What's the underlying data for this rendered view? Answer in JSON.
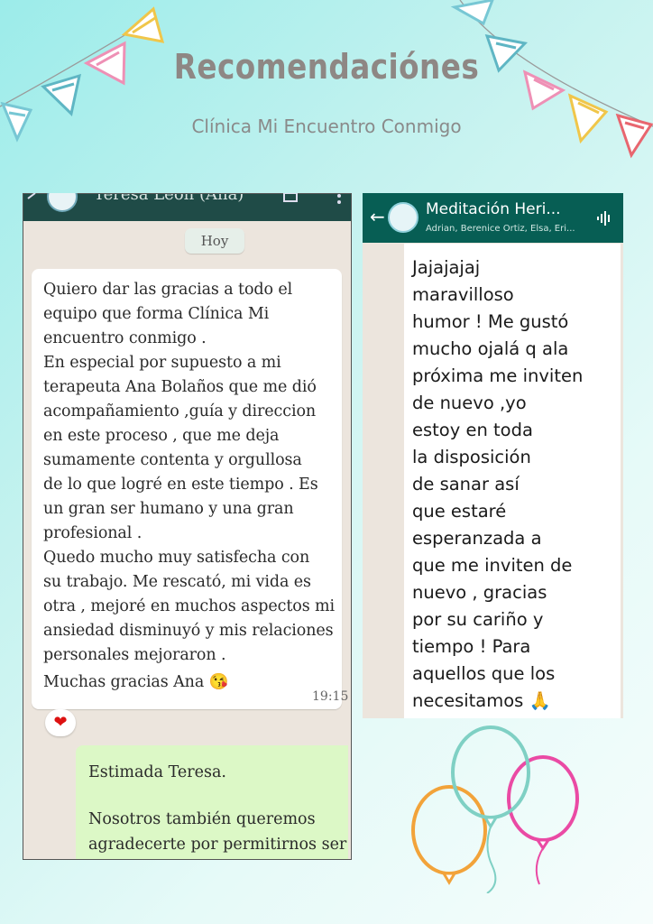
{
  "title": "Recomendaciónes",
  "subtitle": "Clínica Mi Encuentro Conmigo",
  "left_chat": {
    "contact_name": "Teresa León (Ana)",
    "day_chip": "Hoy",
    "message_lines": [
      "Quiero dar las gracias a todo el",
      "equipo que forma Clínica Mi",
      "encuentro conmigo .",
      "En especial por supuesto a mi",
      "terapeuta Ana Bolaños que me dió",
      "acompañamiento ,guía y direccion",
      "en este proceso , que me deja",
      "sumamente contenta y orgullosa",
      "de lo que logré en este tiempo . Es",
      "un gran ser humano y una gran",
      "profesional .",
      "Quedo mucho muy satisfecha con",
      "su trabajo. Me rescató, mi vida es",
      "otra , mejoré en muchos aspectos mi",
      "ansiedad disminuyó y mis relaciones",
      "personales mejoraron .",
      "Muchas gracias Ana 😘"
    ],
    "time": "19:15",
    "reaction": "❤",
    "reply_lines": [
      "Estimada Teresa.",
      "",
      "Nosotros también queremos",
      "agradecerte por permitirnos ser"
    ]
  },
  "right_chat": {
    "group_name": "Meditación  Heri...",
    "members": "Adrian, Berenice Ortiz, Elsa, Eri...",
    "message_lines": [
      "Jajajajaj",
      "maravilloso",
      "humor ! Me gustó",
      "mucho ojalá q ala",
      "próxima me inviten",
      "de nuevo ,yo",
      "estoy en toda",
      "la disposición",
      "de sanar así",
      "que estaré",
      "esperanzada a",
      "que me inviten de",
      "nuevo , gracias",
      "por su cariño y",
      "tiempo ! Para",
      "aquellos que los",
      "necesitamos 🙏"
    ]
  },
  "colors": {
    "bg": "#b9efec",
    "title": "#8e8784",
    "wa_header": "#075e54",
    "bubble_out": "#dcf8c6"
  }
}
